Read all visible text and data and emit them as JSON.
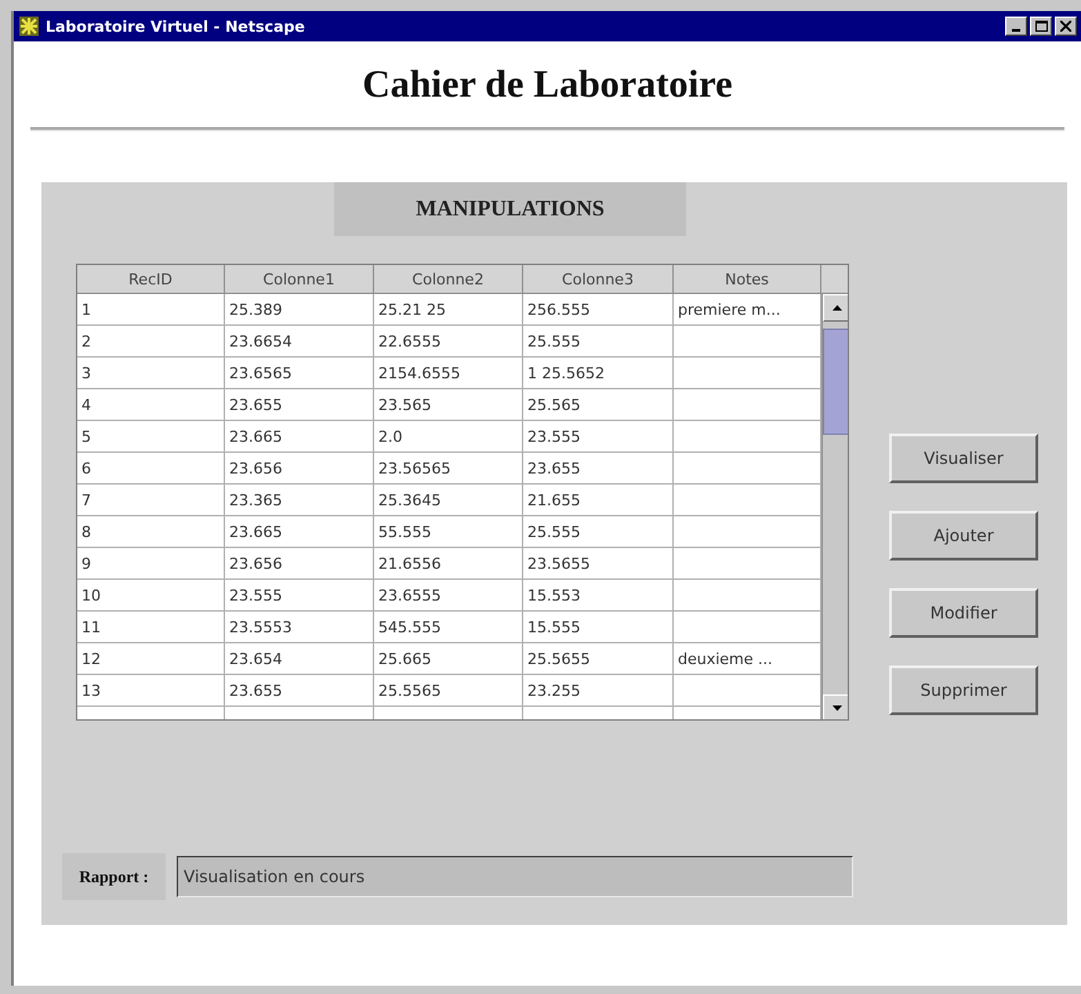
{
  "window": {
    "title": "Laboratoire Virtuel - Netscape"
  },
  "heading": "Cahier de Laboratoire",
  "section_title": "MANIPULATIONS",
  "table": {
    "columns": [
      "RecID",
      "Colonne1",
      "Colonne2",
      "Colonne3",
      "Notes"
    ],
    "rows": [
      [
        "1",
        "25.389",
        "25.21 25",
        "256.555",
        "premiere m..."
      ],
      [
        "2",
        "23.6654",
        "22.6555",
        "25.555",
        ""
      ],
      [
        "3",
        "23.6565",
        "2154.6555",
        "1 25.5652",
        ""
      ],
      [
        "4",
        "23.655",
        "23.565",
        "25.565",
        ""
      ],
      [
        "5",
        "23.665",
        "2.0",
        "23.555",
        ""
      ],
      [
        "6",
        "23.656",
        "23.56565",
        "23.655",
        ""
      ],
      [
        "7",
        "23.365",
        "25.3645",
        "21.655",
        ""
      ],
      [
        "8",
        "23.665",
        "55.555",
        "25.555",
        ""
      ],
      [
        "9",
        "23.656",
        "21.6556",
        "23.5655",
        ""
      ],
      [
        "10",
        "23.555",
        "23.6555",
        "15.553",
        ""
      ],
      [
        "11",
        "23.5553",
        "545.555",
        "15.555",
        ""
      ],
      [
        "12",
        "23.654",
        "25.665",
        "25.5655",
        "deuxieme ..."
      ],
      [
        "13",
        "23.655",
        "25.5565",
        "23.255",
        ""
      ]
    ]
  },
  "buttons": [
    "Visualiser",
    "Ajouter",
    "Modifier",
    "Supprimer"
  ],
  "report": {
    "label": "Rapport :",
    "value": "Visualisation en cours"
  }
}
